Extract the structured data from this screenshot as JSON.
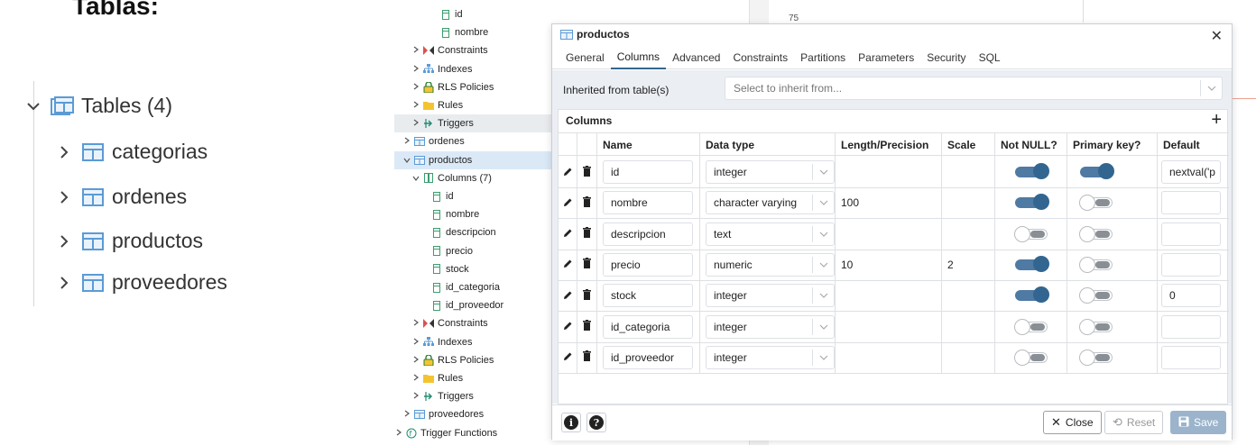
{
  "heading": "Tablas:",
  "left_tree": {
    "tables_label": "Tables (4)",
    "items": [
      "categorias",
      "ordenes",
      "productos",
      "proveedores"
    ]
  },
  "browser_tree": [
    {
      "label": "id",
      "icon": "column-icon",
      "level": 4,
      "chevron": ""
    },
    {
      "label": "nombre",
      "icon": "column-icon",
      "level": 4,
      "chevron": ""
    },
    {
      "label": "Constraints",
      "icon": "constraints-icon",
      "level": 2,
      "chevron": ">"
    },
    {
      "label": "Indexes",
      "icon": "indexes-icon",
      "level": 2,
      "chevron": ">"
    },
    {
      "label": "RLS Policies",
      "icon": "rls-policies-icon",
      "level": 2,
      "chevron": ">"
    },
    {
      "label": "Rules",
      "icon": "rules-icon",
      "level": 2,
      "chevron": ">"
    },
    {
      "label": "Triggers",
      "icon": "triggers-icon",
      "level": 2,
      "chevron": ">",
      "highlight": "grey"
    },
    {
      "label": "ordenes",
      "icon": "table-icon",
      "level": 1,
      "chevron": ">"
    },
    {
      "label": "productos",
      "icon": "table-icon",
      "level": 1,
      "chevron": "v",
      "highlight": "blue"
    },
    {
      "label": "Columns (7)",
      "icon": "columns-icon",
      "level": 2,
      "chevron": "v"
    },
    {
      "label": "id",
      "icon": "column-icon",
      "level": 3,
      "chevron": ""
    },
    {
      "label": "nombre",
      "icon": "column-icon",
      "level": 3,
      "chevron": ""
    },
    {
      "label": "descripcion",
      "icon": "column-icon",
      "level": 3,
      "chevron": ""
    },
    {
      "label": "precio",
      "icon": "column-icon",
      "level": 3,
      "chevron": ""
    },
    {
      "label": "stock",
      "icon": "column-icon",
      "level": 3,
      "chevron": ""
    },
    {
      "label": "id_categoria",
      "icon": "column-icon",
      "level": 3,
      "chevron": ""
    },
    {
      "label": "id_proveedor",
      "icon": "column-icon",
      "level": 3,
      "chevron": ""
    },
    {
      "label": "Constraints",
      "icon": "constraints-icon",
      "level": 2,
      "chevron": ">"
    },
    {
      "label": "Indexes",
      "icon": "indexes-icon",
      "level": 2,
      "chevron": ">"
    },
    {
      "label": "RLS Policies",
      "icon": "rls-policies-icon",
      "level": 2,
      "chevron": ">"
    },
    {
      "label": "Rules",
      "icon": "rules-icon",
      "level": 2,
      "chevron": ">"
    },
    {
      "label": "Triggers",
      "icon": "triggers-icon",
      "level": 2,
      "chevron": ">"
    },
    {
      "label": "proveedores",
      "icon": "table-icon",
      "level": 1,
      "chevron": ">"
    },
    {
      "label": "Trigger Functions",
      "icon": "trigger-functions-icon",
      "level": 0,
      "chevron": ">"
    }
  ],
  "background": {
    "number": "75"
  },
  "dialog": {
    "title": "productos",
    "close_glyph": "✕",
    "tabs": [
      "General",
      "Columns",
      "Advanced",
      "Constraints",
      "Partitions",
      "Parameters",
      "Security",
      "SQL"
    ],
    "active_tab": "Columns",
    "inherited_label": "Inherited from table(s)",
    "inherited_placeholder": "Select to inherit from...",
    "grid_caption": "Columns",
    "add_glyph": "+",
    "headers": [
      "Name",
      "Data type",
      "Length/Precision",
      "Scale",
      "Not NULL?",
      "Primary key?",
      "Default"
    ],
    "rows": [
      {
        "name": "id",
        "type": "integer",
        "length": "",
        "scale": "",
        "not_null": true,
        "primary_key": true,
        "default": "nextval('p"
      },
      {
        "name": "nombre",
        "type": "character varying",
        "length": "100",
        "scale": "",
        "not_null": true,
        "primary_key": false,
        "default": ""
      },
      {
        "name": "descripcion",
        "type": "text",
        "length": "",
        "scale": "",
        "not_null": false,
        "primary_key": false,
        "default": ""
      },
      {
        "name": "precio",
        "type": "numeric",
        "length": "10",
        "scale": "2",
        "not_null": true,
        "primary_key": false,
        "default": ""
      },
      {
        "name": "stock",
        "type": "integer",
        "length": "",
        "scale": "",
        "not_null": true,
        "primary_key": false,
        "default": "0"
      },
      {
        "name": "id_categoria",
        "type": "integer",
        "length": "",
        "scale": "",
        "not_null": false,
        "primary_key": false,
        "default": ""
      },
      {
        "name": "id_proveedor",
        "type": "integer",
        "length": "",
        "scale": "",
        "not_null": false,
        "primary_key": false,
        "default": ""
      }
    ],
    "footer": {
      "info_glyph": "i",
      "help_glyph": "?",
      "close_label": "Close",
      "reset_label": "Reset",
      "save_label": "Save"
    }
  },
  "colors": {
    "accent": "#326690",
    "table_icon": "#5b9bd5",
    "save_disabled": "#9bb4cc"
  }
}
